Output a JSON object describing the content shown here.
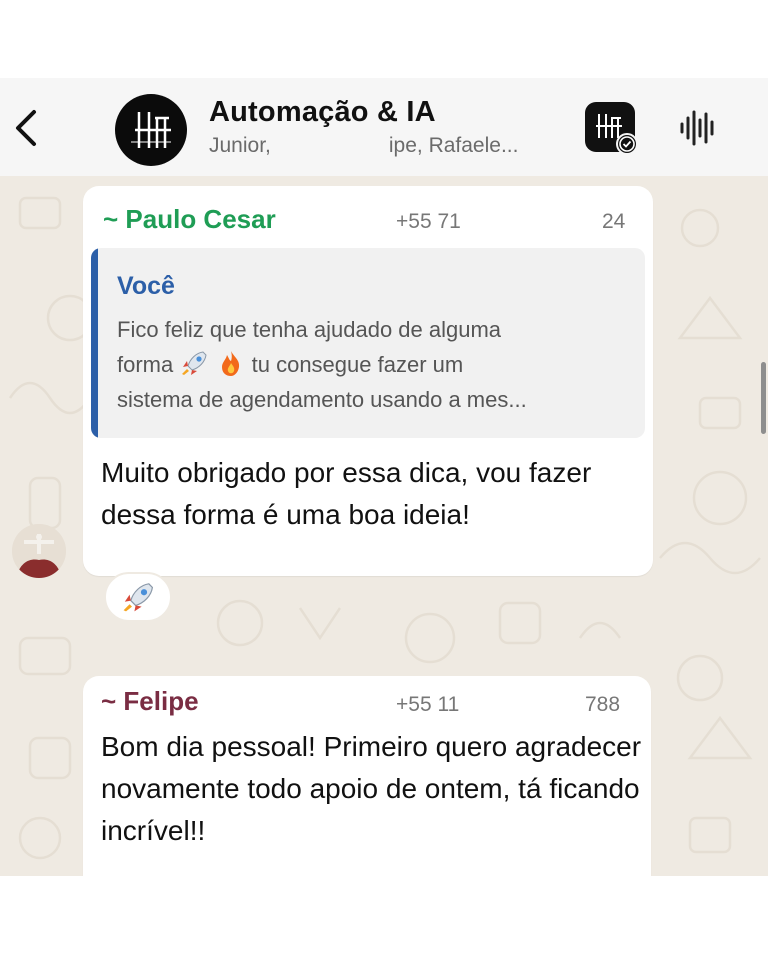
{
  "header": {
    "title": "Automação & IA",
    "subtitle_start": "Junior,",
    "subtitle_end": "ipe, Rafaele...",
    "back_icon": "chevron-left-icon",
    "audio_icon": "waveform-icon"
  },
  "messages": [
    {
      "sender": "~ Paulo Cesar",
      "phone": "+55 71",
      "phone_tail": "24",
      "sender_color": "#1f9d55",
      "quoted": {
        "author": "Você",
        "line1": "Fico feliz que tenha ajudado de alguma",
        "line2_a": "forma",
        "line2_b": "tu consegue fazer um",
        "line3": "sistema de agendamento usando a mes..."
      },
      "text": "Muito obrigado por essa dica, vou fazer dessa forma é uma boa ideia!",
      "reaction": "rocket"
    },
    {
      "sender": "~ Felipe",
      "phone": "+55 11",
      "phone_tail": "788",
      "sender_color": "#7a2d43",
      "text": "Bom dia pessoal! Primeiro quero agradecer novamente todo apoio de ontem, tá ficando incrível!!"
    }
  ],
  "colors": {
    "chat_background": "#efeae2",
    "quote_accent": "#2c5fa8"
  }
}
